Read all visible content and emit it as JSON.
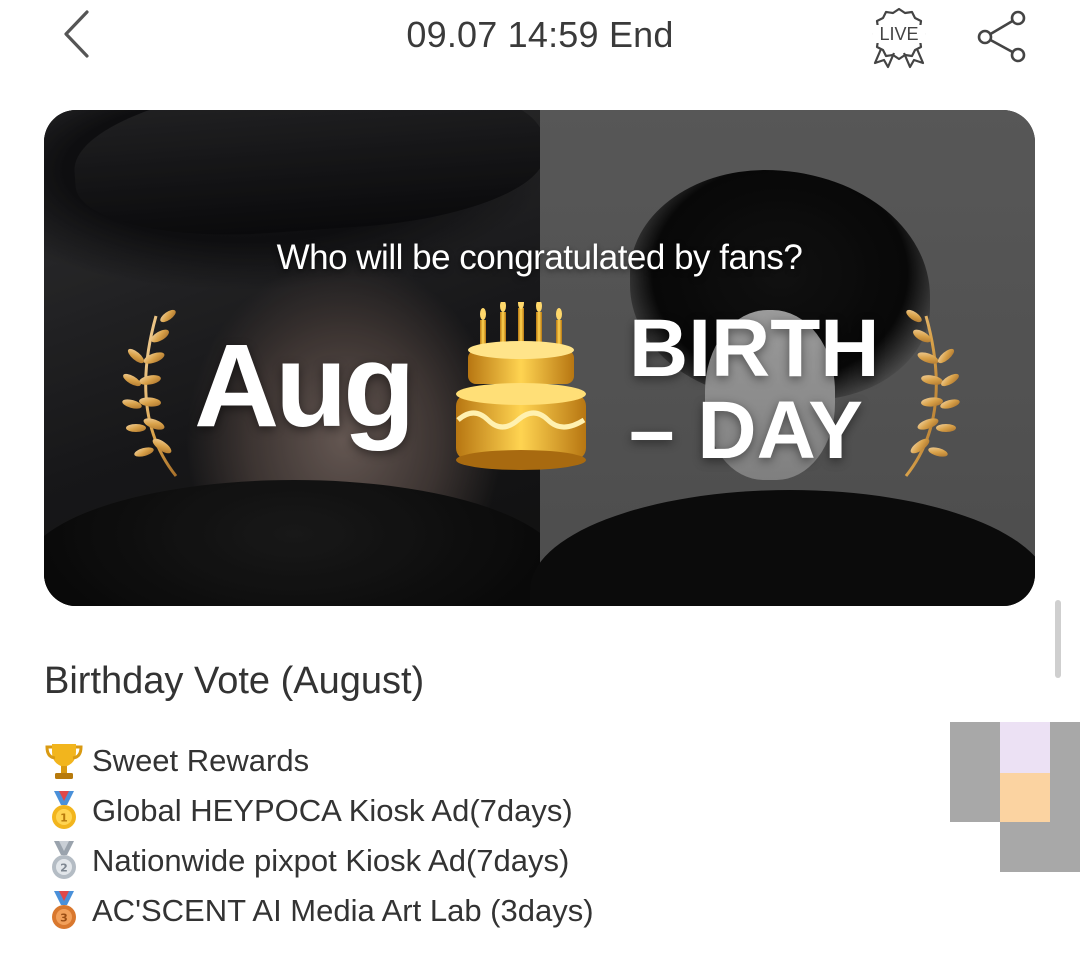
{
  "header": {
    "end_time": "09.07 14:59 End",
    "live_badge": "LIVE",
    "icons": {
      "back": "chevron-left-icon",
      "live": "live-badge-icon",
      "share": "share-icon"
    }
  },
  "banner": {
    "question": "Who will be congratulated by fans?",
    "month": "Aug",
    "birth": "BIRTH",
    "day": "– DAY",
    "icons": {
      "cake": "birthday-cake-icon",
      "laurel": "laurel-icon"
    },
    "colors": {
      "gold": "#d9a24a",
      "text": "#ffffff"
    }
  },
  "vote": {
    "title": "Birthday Vote (August)",
    "rewards": [
      {
        "icon": "trophy-icon",
        "text": "Sweet Rewards"
      },
      {
        "icon": "gold-medal-icon",
        "text": "Global HEYPOCA Kiosk Ad(7days)"
      },
      {
        "icon": "silver-medal-icon",
        "text": "Nationwide pixpot Kiosk Ad(7days)"
      },
      {
        "icon": "bronze-medal-icon",
        "text": "AC'SCENT AI Media Art Lab (3days)"
      }
    ]
  }
}
